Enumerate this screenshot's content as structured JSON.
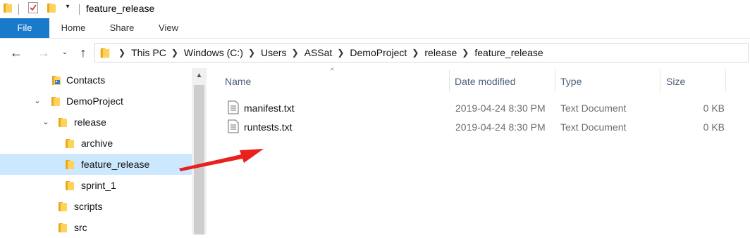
{
  "window": {
    "title": "feature_release"
  },
  "ribbon": {
    "tabs": [
      {
        "label": "File"
      },
      {
        "label": "Home"
      },
      {
        "label": "Share"
      },
      {
        "label": "View"
      }
    ]
  },
  "address": {
    "breadcrumbs": [
      "This PC",
      "Windows (C:)",
      "Users",
      "ASSat",
      "DemoProject",
      "release",
      "feature_release"
    ]
  },
  "sidebar": {
    "items": [
      {
        "label": "Contacts",
        "icon": "contacts-icon"
      },
      {
        "label": "DemoProject",
        "icon": "folder-icon",
        "expanded": true
      },
      {
        "label": "release",
        "icon": "folder-icon",
        "expanded": true
      },
      {
        "label": "archive",
        "icon": "folder-icon"
      },
      {
        "label": "feature_release",
        "icon": "folder-icon",
        "selected": true
      },
      {
        "label": "sprint_1",
        "icon": "folder-icon"
      },
      {
        "label": "scripts",
        "icon": "folder-icon"
      },
      {
        "label": "src",
        "icon": "folder-icon"
      }
    ]
  },
  "filelist": {
    "columns": {
      "name": "Name",
      "date": "Date modified",
      "type": "Type",
      "size": "Size"
    },
    "rows": [
      {
        "name": "manifest.txt",
        "date": "2019-04-24 8:30 PM",
        "type": "Text Document",
        "size": "0 KB"
      },
      {
        "name": "runtests.txt",
        "date": "2019-04-24 8:30 PM",
        "type": "Text Document",
        "size": "0 KB"
      }
    ]
  },
  "colors": {
    "file_tab": "#1979ca",
    "selected_row": "#cce8ff",
    "folder_yellow": "#ffd35b",
    "annotation_arrow": "#e8201e"
  }
}
